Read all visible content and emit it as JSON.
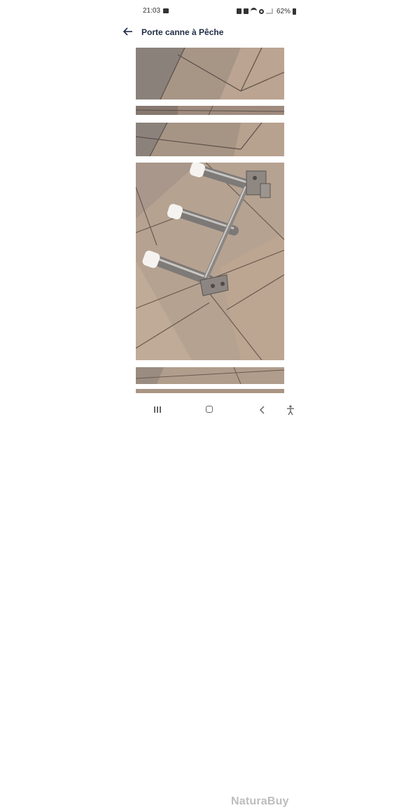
{
  "status_bar": {
    "time": "21:03",
    "battery_percent": "62%",
    "icons": [
      "gallery-icon",
      "notification-icon",
      "notification-icon",
      "wifi-icon",
      "wifi-call-icon",
      "signal-icon",
      "battery-icon"
    ]
  },
  "header": {
    "back_icon": "arrow-left-icon",
    "title": "Porte canne à Pêche"
  },
  "gallery": {
    "photos": [
      {
        "subject": "tiled floor"
      },
      {
        "subject": "tiled floor strip"
      },
      {
        "subject": "tiled floor"
      },
      {
        "subject": "stainless steel fishing rod holder with three white-capped tubes on tiled floor"
      },
      {
        "subject": "tiled floor"
      },
      {
        "subject": "tiled floor strip"
      }
    ]
  },
  "nav_bar": {
    "icons": [
      "recents-icon",
      "home-icon",
      "back-icon",
      "accessibility-icon"
    ],
    "watermark": "NaturaBuy"
  }
}
